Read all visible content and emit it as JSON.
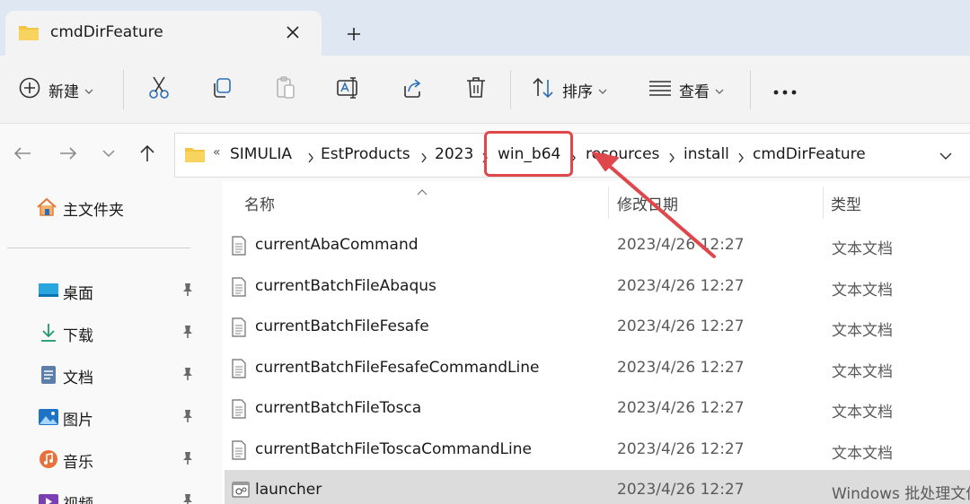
{
  "tab": {
    "title": "cmdDirFeature",
    "close_icon": "close-icon",
    "new_tab_icon": "plus-icon"
  },
  "toolbar": {
    "new_label": "新建",
    "sort_label": "排序",
    "view_label": "查看",
    "icons": [
      "new-icon",
      "cut-icon",
      "copy-icon",
      "paste-icon",
      "rename-icon",
      "share-icon",
      "delete-icon",
      "sort-icon",
      "view-icon",
      "more-icon"
    ]
  },
  "address": {
    "overflow": "«",
    "crumbs": [
      "SIMULIA",
      "EstProducts",
      "2023",
      "win_b64",
      "resources",
      "install",
      "cmdDirFeature"
    ],
    "highlight": "win_b64"
  },
  "sidebar": {
    "home": "主文件夹",
    "items": [
      {
        "label": "桌面",
        "icon": "desktop-icon"
      },
      {
        "label": "下载",
        "icon": "download-icon"
      },
      {
        "label": "文档",
        "icon": "documents-icon"
      },
      {
        "label": "图片",
        "icon": "pictures-icon"
      },
      {
        "label": "音乐",
        "icon": "music-icon"
      },
      {
        "label": "视频",
        "icon": "videos-icon"
      }
    ]
  },
  "columns": {
    "name": "名称",
    "date": "修改日期",
    "type": "类型"
  },
  "files": [
    {
      "name": "currentAbaCommand",
      "date": "2023/4/26 12:27",
      "type": "文本文档"
    },
    {
      "name": "currentBatchFileAbaqus",
      "date": "2023/4/26 12:27",
      "type": "文本文档"
    },
    {
      "name": "currentBatchFileFesafe",
      "date": "2023/4/26 12:27",
      "type": "文本文档"
    },
    {
      "name": "currentBatchFileFesafeCommandLine",
      "date": "2023/4/26 12:27",
      "type": "文本文档"
    },
    {
      "name": "currentBatchFileTosca",
      "date": "2023/4/26 12:27",
      "type": "文本文档"
    },
    {
      "name": "currentBatchFileToscaCommandLine",
      "date": "2023/4/26 12:27",
      "type": "文本文档"
    },
    {
      "name": "launcher",
      "date": "2023/4/26 12:27",
      "type": "Windows 批处理文件"
    }
  ],
  "colors": {
    "annotation": "#e0474c",
    "accent": "#0067c0",
    "folder": "#f4c542"
  }
}
